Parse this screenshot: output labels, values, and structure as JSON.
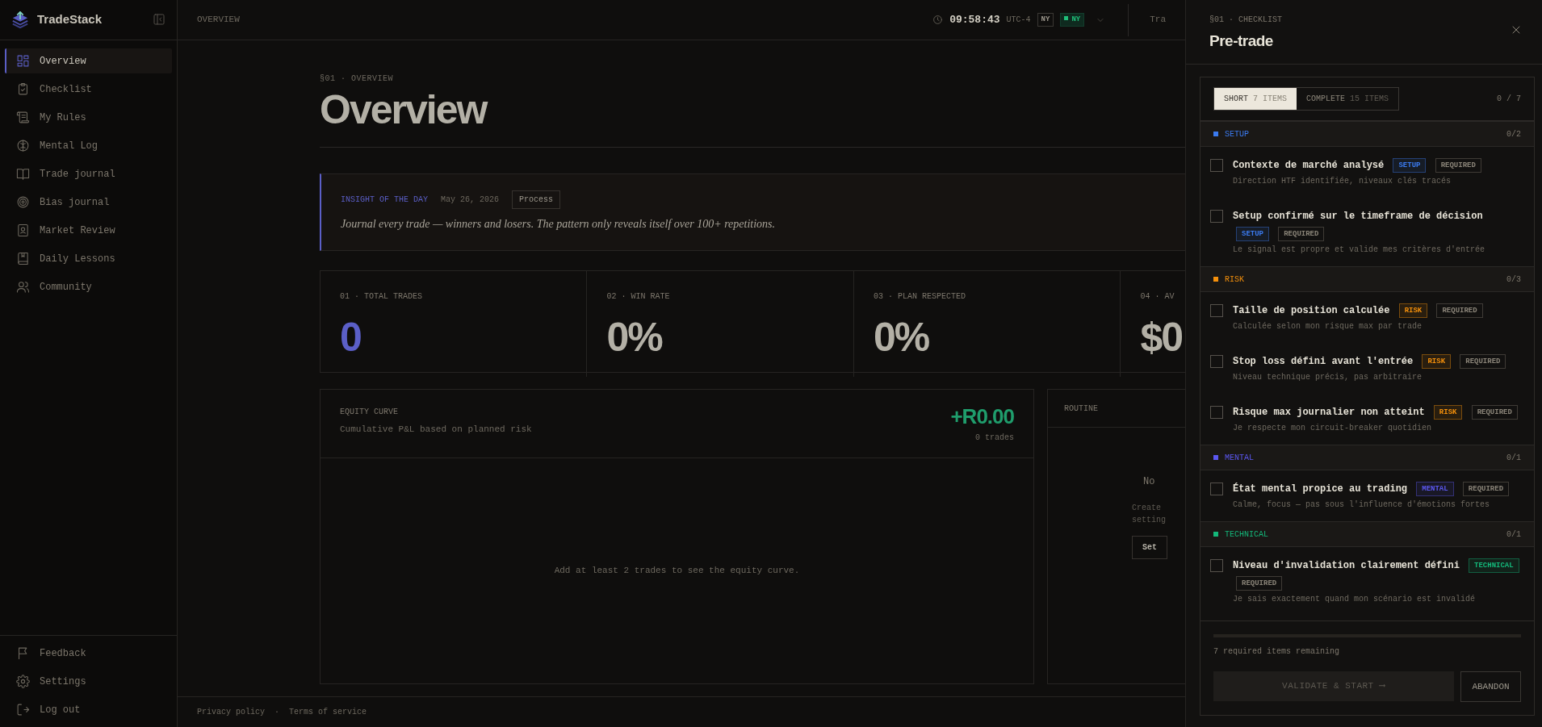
{
  "sidebar": {
    "brand": "TradeStack",
    "nav": [
      {
        "label": "Overview",
        "selected": true
      },
      {
        "label": "Checklist",
        "selected": false
      },
      {
        "label": "My Rules",
        "selected": false
      },
      {
        "label": "Mental Log",
        "selected": false
      },
      {
        "label": "Trade journal",
        "selected": false
      },
      {
        "label": "Bias journal",
        "selected": false
      },
      {
        "label": "Market Review",
        "selected": false
      },
      {
        "label": "Daily Lessons",
        "selected": false
      },
      {
        "label": "Community",
        "selected": false
      }
    ],
    "footer": [
      {
        "label": "Feedback"
      },
      {
        "label": "Settings"
      },
      {
        "label": "Log out"
      }
    ]
  },
  "topbar": {
    "section": "OVERVIEW",
    "time": "09:58:43",
    "timezone": "UTC-4",
    "sessions": [
      {
        "label": "NY",
        "active": false
      },
      {
        "label": "NY",
        "active": true
      }
    ],
    "cut_label": "Tra"
  },
  "page": {
    "eyebrow": "§01 · OVERVIEW",
    "title": "Overview"
  },
  "insight": {
    "label": "INSIGHT OF THE DAY",
    "date": "May 26, 2026",
    "tag": "Process",
    "quote": "Journal every trade — winners and losers. The pattern only reveals itself over 100+ repetitions."
  },
  "stats": [
    {
      "label": "01 · TOTAL TRADES",
      "value": "0",
      "highlight": true
    },
    {
      "label": "02 · WIN RATE",
      "value": "0%",
      "highlight": false
    },
    {
      "label": "03 · PLAN RESPECTED",
      "value": "0%",
      "highlight": false
    },
    {
      "label": "04 · AV",
      "value": "$0",
      "highlight": false
    }
  ],
  "equity": {
    "title": "EQUITY CURVE",
    "subtitle": "Cumulative P&L based on planned risk",
    "total": "+R0.00",
    "count": "0 trades",
    "empty": "Add at least 2 trades to see the equity curve."
  },
  "routine": {
    "title": "ROUTINE",
    "empty_title": "No",
    "lines": [
      "Create",
      "setting"
    ],
    "button": "Set"
  },
  "footer_links": [
    "Privacy policy",
    "Terms of service"
  ],
  "footer_separator": "·",
  "drawer": {
    "eyebrow": "§01 · CHECKLIST",
    "title": "Pre-trade",
    "tabs": [
      {
        "label": "SHORT",
        "count": "7 ITEMS",
        "selected": true
      },
      {
        "label": "COMPLETE",
        "count": "15 ITEMS",
        "selected": false
      }
    ],
    "progress_count": "0 / 7",
    "sections": [
      {
        "name": "SETUP",
        "color": "#3b7bf0",
        "count": "0/2",
        "items": [
          {
            "title": "Contexte de marché analysé",
            "tag": "SETUP",
            "required": "REQUIRED",
            "desc": "Direction HTF identifiée, niveaux clés tracés",
            "checked": false
          },
          {
            "title": "Setup confirmé sur le timeframe de décision",
            "tag": "SETUP",
            "required": "REQUIRED",
            "desc": "Le signal est propre et valide mes critères d'entrée",
            "checked": false
          }
        ]
      },
      {
        "name": "RISK",
        "color": "#f5900b",
        "count": "0/3",
        "items": [
          {
            "title": "Taille de position calculée",
            "tag": "RISK",
            "required": "REQUIRED",
            "desc": "Calculée selon mon risque max par trade",
            "checked": false
          },
          {
            "title": "Stop loss défini avant l'entrée",
            "tag": "RISK",
            "required": "REQUIRED",
            "desc": "Niveau technique précis, pas arbitraire",
            "checked": false
          },
          {
            "title": "Risque max journalier non atteint",
            "tag": "RISK",
            "required": "REQUIRED",
            "desc": "Je respecte mon circuit-breaker quotidien",
            "checked": false
          }
        ]
      },
      {
        "name": "MENTAL",
        "color": "#5b57f0",
        "count": "0/1",
        "items": [
          {
            "title": "État mental propice au trading",
            "tag": "MENTAL",
            "required": "REQUIRED",
            "desc": "Calme, focus — pas sous l'influence d'émotions fortes",
            "checked": false
          }
        ]
      },
      {
        "name": "TECHNICAL",
        "color": "#14b87a",
        "count": "0/1",
        "items": [
          {
            "title": "Niveau d'invalidation clairement défini",
            "tag": "TECHNICAL",
            "required": "REQUIRED",
            "desc": "Je sais exactement quand mon scénario est invalidé",
            "checked": false
          }
        ]
      }
    ],
    "progress": {
      "level": 0
    },
    "remaining": "7 required items remaining",
    "buttons": [
      {
        "label": "VALIDATE & START ⟶",
        "kind": "primary",
        "disabled": true
      },
      {
        "label": "ABANDON",
        "kind": "secondary",
        "disabled": false
      }
    ]
  }
}
